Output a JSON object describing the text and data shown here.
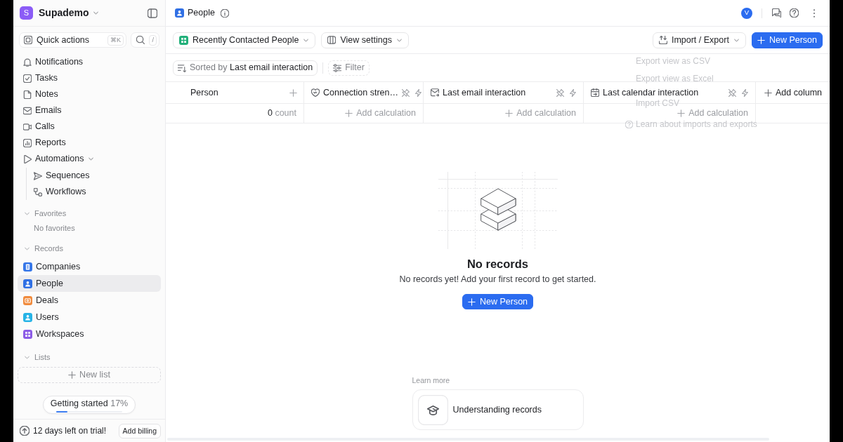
{
  "sidebar": {
    "workspace": {
      "initial": "S",
      "name": "Supademo"
    },
    "quick_actions": {
      "label": "Quick actions",
      "shortcut": "⌘K"
    },
    "search": {
      "shortcut": "/"
    },
    "nav_items": [
      {
        "label": "Notifications",
        "selected": false
      },
      {
        "label": "Tasks",
        "selected": false
      },
      {
        "label": "Notes",
        "selected": false
      },
      {
        "label": "Emails",
        "selected": false
      },
      {
        "label": "Calls",
        "selected": false
      },
      {
        "label": "Reports",
        "selected": false
      },
      {
        "label": "Automations",
        "selected": false,
        "expanded": true,
        "children": [
          {
            "label": "Sequences",
            "selected": false
          },
          {
            "label": "Workflows",
            "selected": false
          }
        ]
      }
    ],
    "favorites": {
      "title": "Favorites",
      "expanded": true,
      "empty_text": "No favorites"
    },
    "records": {
      "title": "Records",
      "expanded": true,
      "items": [
        {
          "label": "Companies",
          "color": "#3576e8",
          "selected": false
        },
        {
          "label": "People",
          "color": "#2f6fe4",
          "selected": true
        },
        {
          "label": "Deals",
          "color": "#f08a3c",
          "selected": false
        },
        {
          "label": "Users",
          "color": "#26b3e6",
          "selected": false
        },
        {
          "label": "Workspaces",
          "color": "#8c5ce6",
          "selected": false
        }
      ]
    },
    "lists": {
      "title": "Lists",
      "expanded": true,
      "new_button": "New list"
    },
    "getting_started": {
      "label": "Getting started",
      "percent": "17%",
      "level": 0.17
    },
    "trial": {
      "text": "12 days left on trial!",
      "button": "Add billing"
    }
  },
  "header": {
    "title": "People",
    "avatar": "V"
  },
  "toolbar": {
    "view": "Recently Contacted People",
    "view_settings": "View settings",
    "import_export": "Import / Export",
    "new_button": "New Person"
  },
  "import_export_menu": {
    "items": [
      {
        "kind": "action",
        "label": "Export view as CSV"
      },
      {
        "kind": "action",
        "label": "Export view as Excel"
      },
      {
        "kind": "action",
        "label": "Import CSV"
      },
      {
        "kind": "help",
        "label": "Learn about imports and exports"
      }
    ]
  },
  "filters": {
    "sort_label": "Sorted by",
    "sort_value": "Last email interaction",
    "filter": "Filter"
  },
  "table": {
    "columns": [
      {
        "kind": "primary",
        "label": "Person"
      },
      {
        "kind": "attribute",
        "label": "Connection stren…"
      },
      {
        "kind": "attribute",
        "label": "Last email interaction"
      },
      {
        "kind": "attribute",
        "label": "Last calendar interaction"
      }
    ],
    "add_column": "Add column",
    "calculations": [
      {
        "kind": "count",
        "value": "0",
        "label": "count"
      },
      {
        "kind": "add",
        "label": "Add calculation"
      },
      {
        "kind": "add",
        "label": "Add calculation"
      },
      {
        "kind": "add",
        "label": "Add calculation"
      }
    ]
  },
  "empty_state": {
    "title": "No records",
    "text": "No records yet! Add your first record to get started.",
    "button": "New Person"
  },
  "learn_more": {
    "label": "Learn more",
    "cards": [
      {
        "title": "Understanding records"
      }
    ]
  }
}
